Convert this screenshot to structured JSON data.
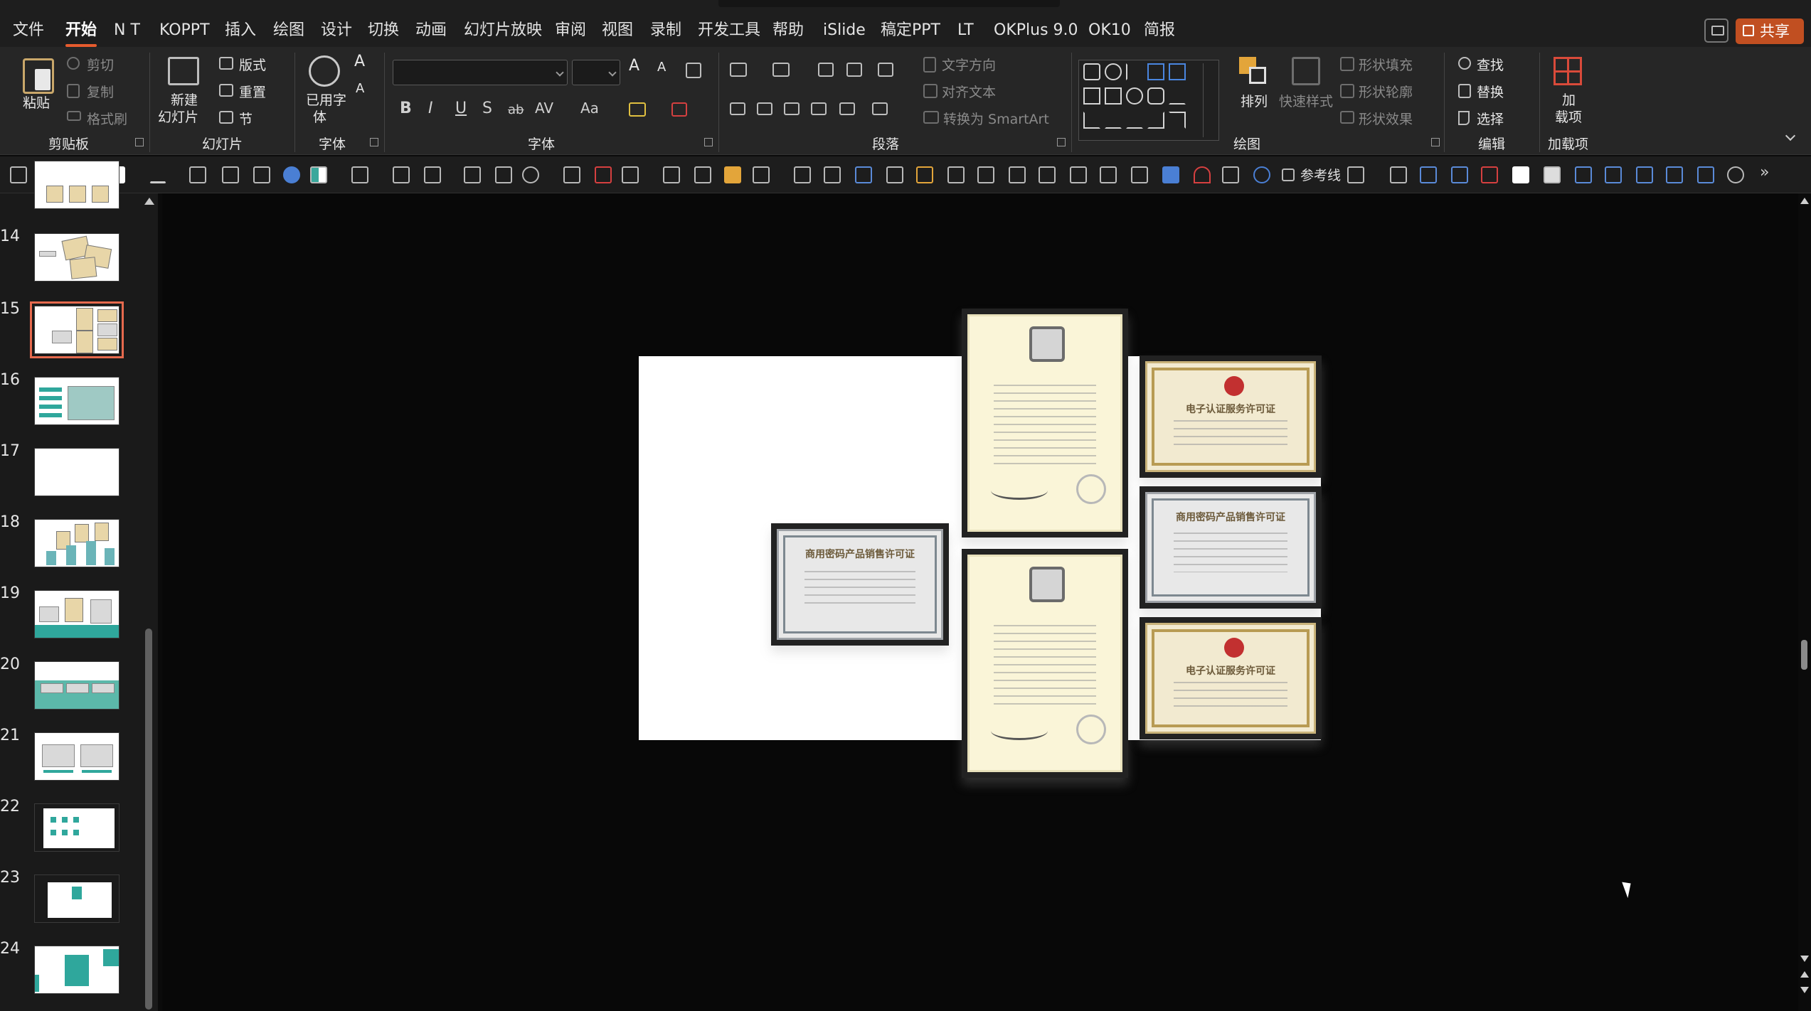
{
  "menu": {
    "items": [
      "文件",
      "开始",
      "N T",
      "KOPPT",
      "插入",
      "绘图",
      "设计",
      "切换",
      "动画",
      "幻灯片放映",
      "审阅",
      "视图",
      "录制",
      "开发工具",
      "帮助",
      "iSlide",
      "稿定PPT",
      "LT",
      "OKPlus 9.0",
      "OK10",
      "简报"
    ],
    "active": "开始",
    "share_label": "共享"
  },
  "ribbon": {
    "clipboard": {
      "paste": "粘贴",
      "cut": "剪切",
      "copy": "复制",
      "format_painter": "格式刷",
      "group_label": "剪贴板"
    },
    "slides": {
      "new_slide_line1": "新建",
      "new_slide_line2": "幻灯片",
      "layout": "版式",
      "reset": "重置",
      "section": "节",
      "group_label": "幻灯片"
    },
    "used_font": {
      "line1": "已用字",
      "line2": "体",
      "group_label": "字体"
    },
    "font": {
      "font_name": "",
      "font_size": "",
      "bold": "B",
      "italic": "I",
      "underline": "U",
      "shadow": "S",
      "strike": "ab",
      "spacing": "AV",
      "case": "Aa",
      "grow": "A",
      "shrink": "A",
      "group_label": "字体"
    },
    "paragraph": {
      "text_direction": "文字方向",
      "align_text": "对齐文本",
      "smartart": "转换为 SmartArt",
      "group_label": "段落"
    },
    "drawing": {
      "arrange": "排列",
      "quick_styles": "快速样式",
      "shape_fill": "形状填充",
      "shape_outline": "形状轮廓",
      "shape_effects": "形状效果",
      "group_label": "绘图"
    },
    "editing": {
      "find": "查找",
      "replace": "替换",
      "select": "选择",
      "group_label": "编辑"
    },
    "addins": {
      "line1": "加",
      "line2": "载项",
      "group_label": "加载项"
    }
  },
  "qat": {
    "guides_label": "参考线",
    "more": "»"
  },
  "slides_panel": {
    "numbers": [
      "14",
      "15",
      "16",
      "17",
      "18",
      "19",
      "20",
      "21",
      "22",
      "23",
      "24"
    ],
    "active": "15"
  },
  "canvas": {
    "certificates": [
      {
        "id": "cert-small-left",
        "title": "商用密码产品销售许可证",
        "style": "gray"
      },
      {
        "id": "cert-tall-top",
        "title": "",
        "style": "cream"
      },
      {
        "id": "cert-tall-bottom",
        "title": "",
        "style": "cream"
      },
      {
        "id": "cert-right-1",
        "title": "电子认证服务许可证",
        "style": "gold"
      },
      {
        "id": "cert-right-2",
        "title": "商用密码产品销售许可证",
        "style": "gray"
      },
      {
        "id": "cert-right-3",
        "title": "电子认证服务许可证",
        "style": "gold"
      }
    ]
  },
  "colors": {
    "accent": "#e65b2e",
    "share_bg": "#c14f21",
    "active_thumb_outline": "#e66a4e"
  }
}
